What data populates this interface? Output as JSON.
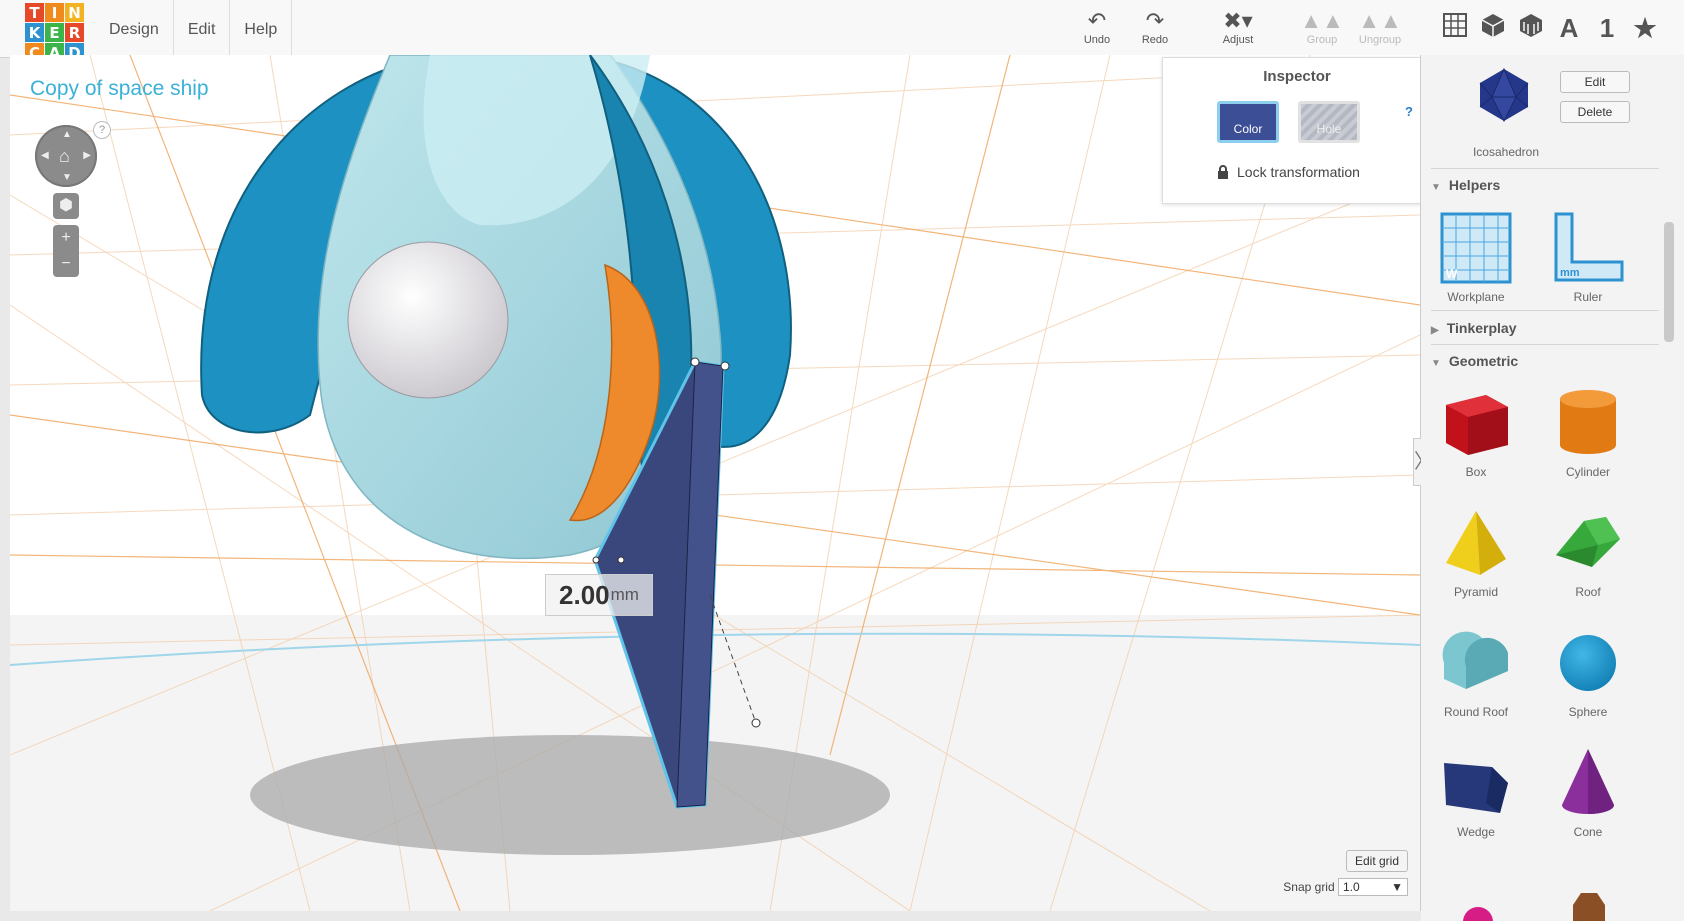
{
  "logo": {
    "letters": [
      "T",
      "I",
      "N",
      "K",
      "E",
      "R",
      "C",
      "A",
      "D"
    ],
    "colors": [
      "#e5492a",
      "#f08a1d",
      "#f3b21f",
      "#2e92d0",
      "#3bb54a",
      "#e5492a",
      "#f08a1d",
      "#3bb54a",
      "#2e92d0"
    ]
  },
  "menu": {
    "items": [
      "Design",
      "Edit",
      "Help"
    ]
  },
  "toolbar": {
    "undo": "Undo",
    "redo": "Redo",
    "adjust": "Adjust",
    "group": "Group",
    "ungroup": "Ungroup"
  },
  "view_icons": {
    "text_a": "A",
    "text_one": "1"
  },
  "project": {
    "title": "Copy of space ship"
  },
  "inspector": {
    "title": "Inspector",
    "color_label": "Color",
    "hole_label": "Hole",
    "help": "?",
    "lock_label": "Lock transformation",
    "selected_color": "#3b4e96"
  },
  "viewport": {
    "dimension_value": "2.00",
    "dimension_unit": "mm",
    "edit_grid": "Edit grid",
    "snap_grid_label": "Snap grid",
    "snap_grid_value": "1.0",
    "nav_help": "?"
  },
  "panel": {
    "selected_shape": "Icosahedron",
    "edit_label": "Edit",
    "delete_label": "Delete",
    "helpers_title": "Helpers",
    "helpers": [
      "Workplane",
      "Ruler"
    ],
    "tinkerplay_title": "Tinkerplay",
    "geometric_title": "Geometric",
    "shapes": [
      "Box",
      "Cylinder",
      "Pyramid",
      "Roof",
      "Round Roof",
      "Sphere",
      "Wedge",
      "Cone"
    ]
  }
}
